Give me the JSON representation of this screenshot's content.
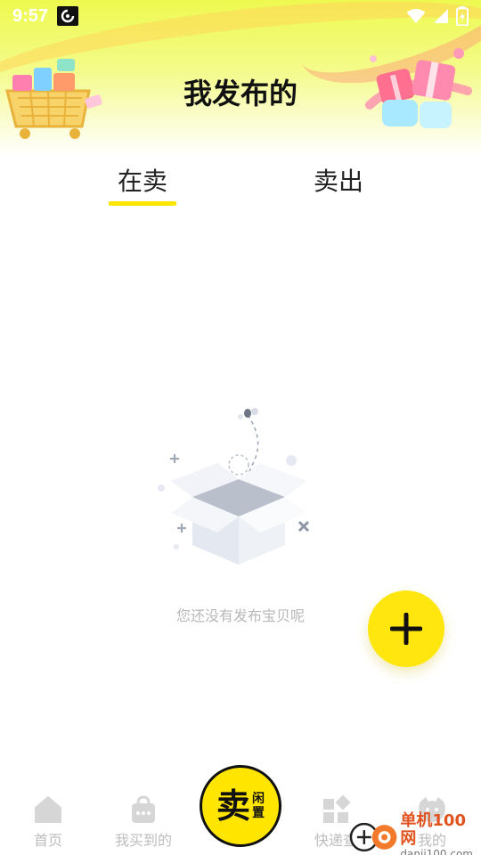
{
  "status_bar": {
    "time": "9:57",
    "icons": [
      "wifi-icon",
      "signal-icon",
      "battery-charging-icon"
    ]
  },
  "header": {
    "title": "我发布的"
  },
  "tabs": [
    {
      "label": "在卖",
      "active": true
    },
    {
      "label": "卖出",
      "active": false
    }
  ],
  "empty_state": {
    "message": "您还没有发布宝贝呢",
    "icon": "empty-box-icon"
  },
  "fab": {
    "icon": "plus-icon"
  },
  "bottom_nav": {
    "items": [
      {
        "label": "首页",
        "icon": "home-icon"
      },
      {
        "label": "我买到的",
        "icon": "shopping-bag-icon"
      },
      {
        "label": "快递查",
        "icon": "grid-icon"
      },
      {
        "label": "我的",
        "icon": "profile-icon"
      }
    ],
    "sell": {
      "main": "卖",
      "sub_top": "闲",
      "sub_bottom": "置"
    }
  },
  "watermark": {
    "name": "单机100网",
    "url": "danji100.com"
  },
  "colors": {
    "accent": "#ffe500",
    "header_gradient_top": "#eef94f",
    "muted_text": "#b8b8b8"
  }
}
